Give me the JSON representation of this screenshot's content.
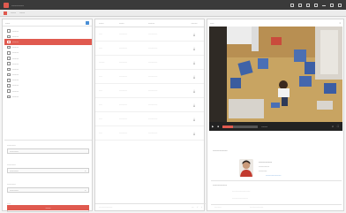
{
  "window": {
    "title": "~~~~~~~~"
  },
  "menubar": {
    "items": [
      "~~~~",
      "~~~~"
    ]
  },
  "left_panel": {
    "header": "~~~",
    "tree_items": [
      {
        "label": "~~~~~",
        "selected": false
      },
      {
        "label": "~~~~~",
        "selected": false
      },
      {
        "label": "~~~~~",
        "selected": true
      },
      {
        "label": "~~~~~",
        "selected": false
      },
      {
        "label": "~~~~~",
        "selected": false
      },
      {
        "label": "~~~~~",
        "selected": false
      },
      {
        "label": "~~~~~",
        "selected": false
      },
      {
        "label": "~~~~~",
        "selected": false
      },
      {
        "label": "~~~~~",
        "selected": false
      },
      {
        "label": "~~~~~",
        "selected": false
      },
      {
        "label": "~~~~~",
        "selected": false
      },
      {
        "label": "~~~~~",
        "selected": false
      },
      {
        "label": "~~~~~",
        "selected": false
      }
    ],
    "filters": [
      {
        "label": "~~~~~~~",
        "value": "~~~~~~~"
      },
      {
        "label": "~~~~~~~",
        "value": "~~~~~~~"
      },
      {
        "label": "~~~~~~~",
        "value": "~~~~~~~"
      },
      {
        "label": "~~~",
        "value": "~~"
      }
    ],
    "search_button": "~~~~"
  },
  "list_panel": {
    "columns": [
      "~~~~",
      "~~~~",
      "~~~~~",
      "~~~~~"
    ],
    "rows": [
      [
        "~~~",
        "~~~~~~~",
        "~~~~~~~~",
        "⤓"
      ],
      [
        "~~~",
        "~~~~~~~",
        "~~~~~~~~",
        "⤓"
      ],
      [
        "~~~~~",
        "~~~~~~~",
        "~~~~~~~~",
        "⤓"
      ],
      [
        "~~~",
        "~~~~~~~",
        "~~~~~~~~",
        "⤓"
      ],
      [
        "~~~",
        "~~~~~~~",
        "~~~~~~~~",
        "⤓"
      ],
      [
        "~~~",
        "~~~~~~~",
        "~~~~~~~~",
        "⤓"
      ],
      [
        "~~~",
        "~~~~~~~",
        "~~~~~~~~",
        "⤓"
      ],
      [
        "~~~",
        "~~~~~~~",
        "~~~~~~~~",
        "⤓"
      ]
    ],
    "footer": {
      "summary": "~~~~~~~~~~~~",
      "per_page": "~~",
      "prev": "‹",
      "next": "›"
    }
  },
  "detail_panel": {
    "header": "~~~",
    "close_glyph": "×",
    "video": {
      "progress_percent": 30,
      "time": "~~~~"
    },
    "info_title": "~~~~~~~~~~~",
    "person": {
      "name": "~~~~~~~~~~",
      "line1": "~~~~~~~~~",
      "line2": "~~~~~~~",
      "link": "~~~~~~~~~~~~~"
    },
    "section_title": "~~~~~~~~~~~",
    "section_lines": [
      "~~~~~~~~~~~~~~~~",
      "~~~~~~~~~~~~~~"
    ],
    "footer_left": "~~~~~~",
    "footer_right": "~~~~~~~~~~~~"
  },
  "colors": {
    "accent": "#e05a4f",
    "link": "#4a8fd6",
    "titlebar": "#3a3a3a"
  }
}
